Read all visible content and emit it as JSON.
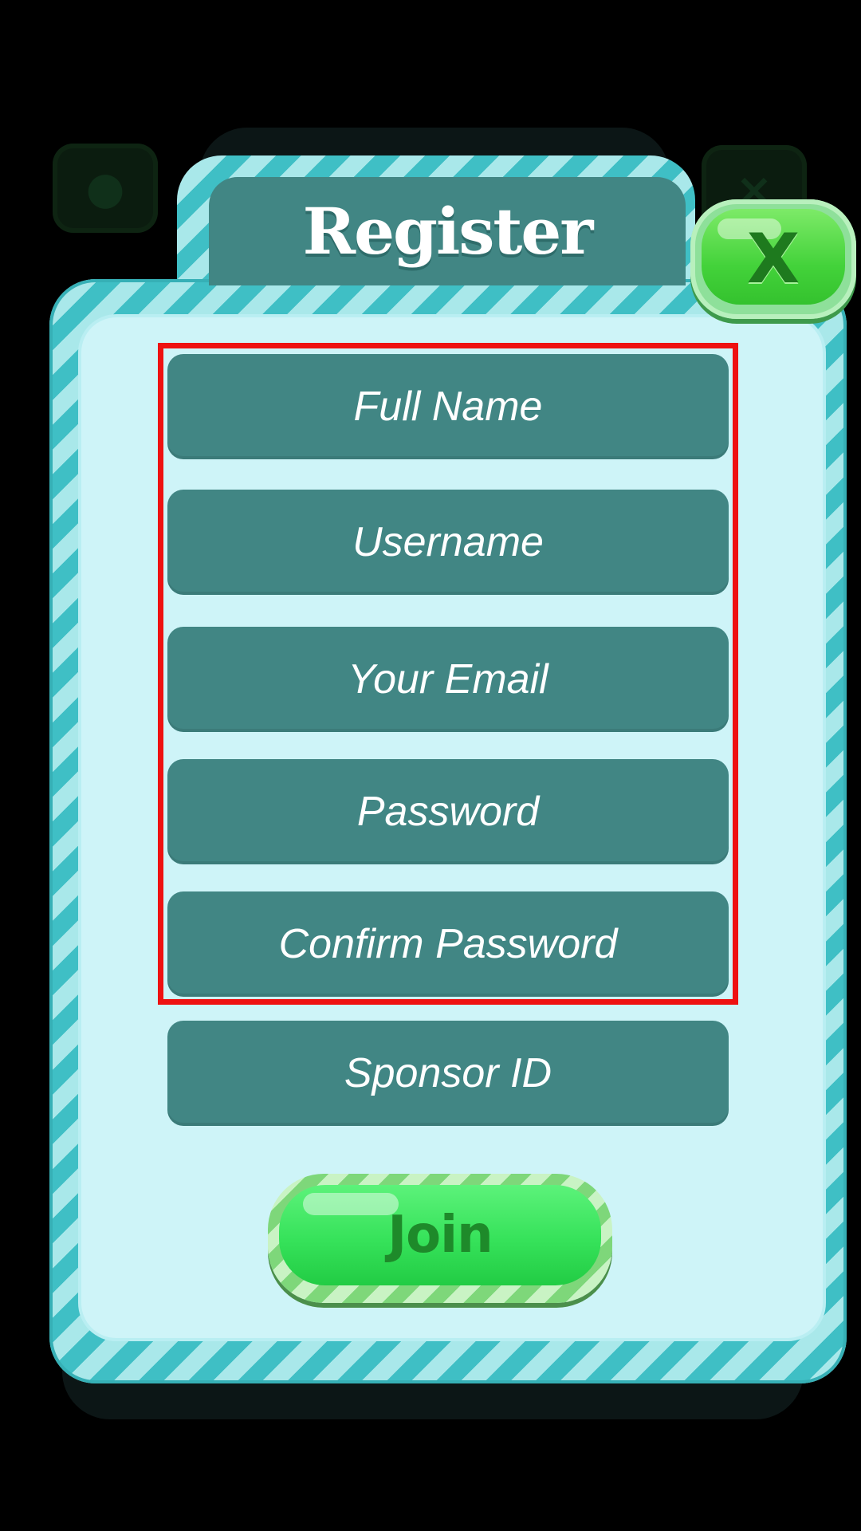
{
  "dialog": {
    "title": "Register",
    "close_label": "X"
  },
  "form": {
    "fields": [
      {
        "placeholder": "Full Name"
      },
      {
        "placeholder": "Username"
      },
      {
        "placeholder": "Your Email"
      },
      {
        "placeholder": "Password"
      },
      {
        "placeholder": "Confirm Password"
      },
      {
        "placeholder": "Sponsor ID"
      }
    ],
    "submit_label": "Join"
  },
  "icons": {
    "background_left": "profile-icon",
    "background_right": "close-icon",
    "close_button": "close-icon"
  },
  "colors": {
    "field_background": "#418684",
    "panel_background": "#cef4f8",
    "stripe_dark": "#3fbfc5",
    "stripe_light": "#a9e8ea",
    "button_green": "#36e25a",
    "highlight_border": "#ee1111"
  }
}
